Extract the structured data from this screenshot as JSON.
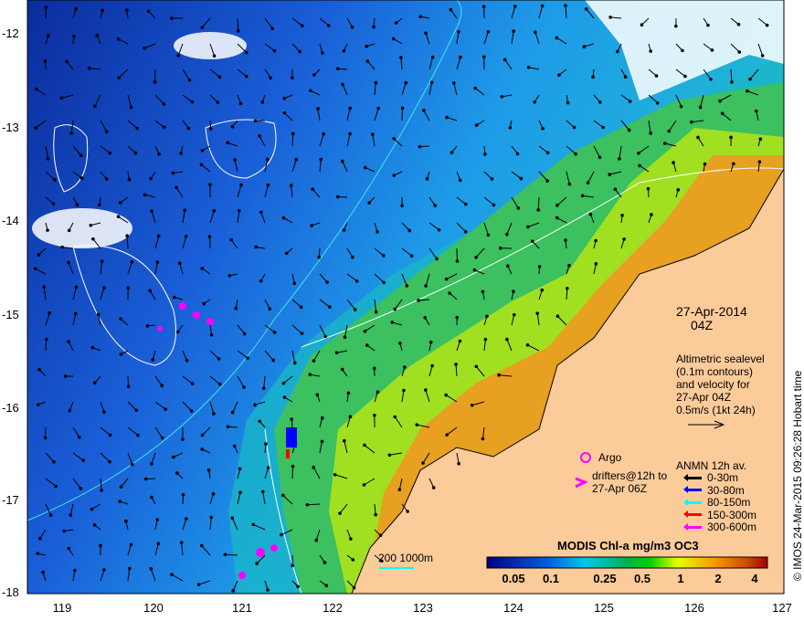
{
  "map": {
    "date": "27-Apr-2014",
    "time": "04Z",
    "altimetry_note": [
      "Altimetric sealevel",
      "(0.1m contours)",
      "and velocity for",
      "27-Apr 04Z",
      "0.5m/s (1kt 24h)"
    ],
    "argo_label": "Argo",
    "drifters_label": [
      "drifters@12h to",
      "27-Apr 06Z"
    ],
    "anmn_title": "ANMN 12h av.",
    "anmn_depths": [
      {
        "label": "0-30m",
        "color": "#000000"
      },
      {
        "label": "30-80m",
        "color": "#0000ff"
      },
      {
        "label": "80-150m",
        "color": "#00ffff"
      },
      {
        "label": "150-300m",
        "color": "#ff0000"
      },
      {
        "label": "300-600m",
        "color": "#ff00ff"
      }
    ],
    "isobath_label": "200  1000m",
    "colorbar_title": "MODIS Chl-a mg/m3 OC3",
    "colorbar_ticks": [
      "0.05",
      "0.1",
      "0.25",
      "0.5",
      "1",
      "2",
      "4"
    ],
    "y_ticks": [
      "-12",
      "-13",
      "-14",
      "-15",
      "-16",
      "-17",
      "-18"
    ],
    "x_ticks": [
      "119",
      "120",
      "121",
      "122",
      "123",
      "124",
      "125",
      "126",
      "127"
    ],
    "credit": "© IMOS 24-Mar-2015 09:26:28 Hobart time",
    "colors": {
      "land": "#fccb9a",
      "ocean_deep": "#0a2a9a",
      "marker": "#ff00ff"
    }
  }
}
